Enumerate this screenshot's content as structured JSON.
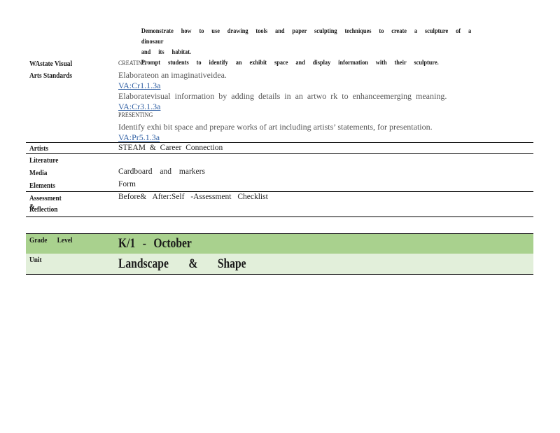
{
  "activities": [
    {
      "bullet": "",
      "text": "Demonstrate how to use drawing tools and paper sculpting techniques to create a sculpture of a dinosaur"
    },
    {
      "bullet": "",
      "text": "and its habitat."
    },
    {
      "bullet": "",
      "text": "Prompt students to identify an exhibit space and display information with their sculpture."
    }
  ],
  "standards": {
    "label_line1": "WAstate Visual",
    "label_line2": "Arts Standards",
    "creating_heading": "CREATING",
    "item1_text": "Elaborateon an imaginativeidea.",
    "item1_code": "VA:Cr1.1.3a",
    "item2_text": "Elaboratevisual information by adding details in an artwo rk to enhanceemerging meaning.",
    "item2_code": "VA:Cr3.1.3a",
    "presenting_heading": "PRESENTING",
    "item3_text": "Identify exhi bit space and prepare works of art including artists’ statements, for presentation.",
    "item3_code": "VA:Pr5.1.3a"
  },
  "rows": {
    "artists_label": "Artists",
    "artists_value": "STEAM & Career Connection",
    "literature_label": "Literature",
    "media_label": "Media",
    "media_value": "Cardboard and markers",
    "elements_label": "Elements",
    "elements_value": "Form",
    "assessment_label": "Assessment &",
    "reflection_label": "Reflection",
    "assessment_value": "Before& After:Self -Assessment Checklist"
  },
  "grade": {
    "label": "Grade Level",
    "value": "K/1 - October"
  },
  "unit": {
    "label": "Unit",
    "value": "Landscape & Shape"
  },
  "colors": {
    "grade_band": "#a9d18e",
    "unit_band": "#e2efda",
    "link": "#2f5fa3"
  }
}
